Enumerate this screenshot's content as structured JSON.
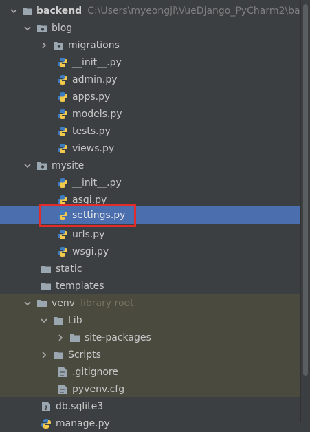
{
  "tree": {
    "rows": [
      {
        "label": "backend",
        "path": "C:\\Users\\myeongji\\VueDjango_PyCharm2\\ba",
        "kind": "folder",
        "expanded": true
      },
      {
        "label": "blog",
        "kind": "package",
        "expanded": true
      },
      {
        "label": "migrations",
        "kind": "package",
        "expanded": false
      },
      {
        "label": "__init__.py",
        "kind": "python"
      },
      {
        "label": "admin.py",
        "kind": "python"
      },
      {
        "label": "apps.py",
        "kind": "python"
      },
      {
        "label": "models.py",
        "kind": "python"
      },
      {
        "label": "tests.py",
        "kind": "python"
      },
      {
        "label": "views.py",
        "kind": "python"
      },
      {
        "label": "mysite",
        "kind": "package",
        "expanded": true
      },
      {
        "label": "__init__.py",
        "kind": "python"
      },
      {
        "label": "asgi.py",
        "kind": "python"
      },
      {
        "label": "settings.py",
        "kind": "python",
        "selected": true
      },
      {
        "label": "urls.py",
        "kind": "python"
      },
      {
        "label": "wsgi.py",
        "kind": "python"
      },
      {
        "label": "static",
        "kind": "folder"
      },
      {
        "label": "templates",
        "kind": "folder"
      },
      {
        "label": "venv",
        "note": "library root",
        "kind": "folder",
        "expanded": true
      },
      {
        "label": "Lib",
        "kind": "folder",
        "expanded": true
      },
      {
        "label": "site-packages",
        "kind": "folder",
        "expanded": false
      },
      {
        "label": "Scripts",
        "kind": "folder",
        "expanded": false
      },
      {
        "label": ".gitignore",
        "kind": "file"
      },
      {
        "label": "pyvenv.cfg",
        "kind": "file"
      },
      {
        "label": "db.sqlite3",
        "kind": "db"
      },
      {
        "label": "manage.py",
        "kind": "python"
      }
    ]
  },
  "colors": {
    "background": "#3c3f41",
    "selection": "#4b6eaf",
    "library_root_bg": "#4b4a3f",
    "highlight_border": "#e22b2b"
  }
}
